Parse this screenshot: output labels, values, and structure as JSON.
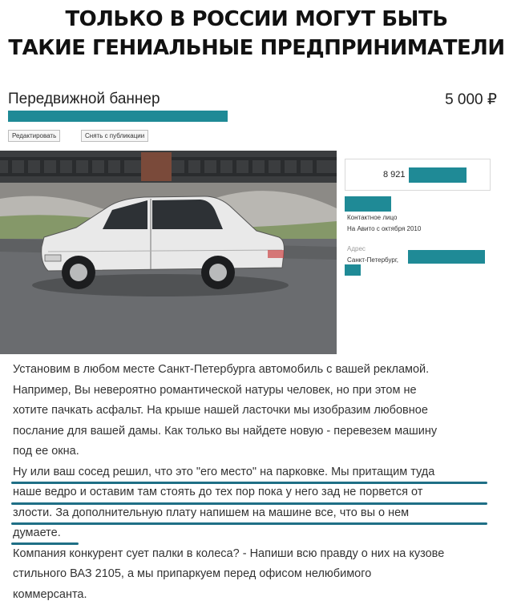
{
  "headline": {
    "line1": "ТОЛЬКО В РОССИИ МОГУТ БЫТЬ",
    "line2": "ТАКИЕ ГЕНИАЛЬНЫЕ ПРЕДПРИНИМАТЕЛИ"
  },
  "listing": {
    "title": "Передвижной баннер",
    "price": "5 000 ₽",
    "edit_button": "Редактировать",
    "unpublish_button": "Снять с публикации"
  },
  "seller": {
    "phone": "8 921",
    "contact_label": "Контактное лицо",
    "since": "На Авито с октября 2010",
    "address_label": "Адрес",
    "city": "Санкт-Петербург,"
  },
  "description": {
    "lines": [
      "Установим в любом месте Санкт-Петербурга автомобиль с вашей рекламой.",
      "Например, Вы невероятно романтической натуры человек, но при этом не",
      "хотите пачкать асфальт. На крыше нашей ласточки мы изобразим любовное",
      "послание для вашей дамы. Как только вы найдете новую - перевезем машину",
      "под ее окна.",
      "Ну или ваш сосед решил, что это \"его место\" на парковке. Мы притащим туда",
      "наше ведро и оставим там стоять до тех пор пока у него зад не порвется от",
      "злости. За дополнительную плату напишем на машине все, что вы о нем",
      "думаете.",
      "Компания конкурент сует палки в колеса? - Напиши всю правду о них на кузове",
      "стильного ВАЗ 2105, а мы припаркуем перед офисом нелюбимого",
      "коммерсанта."
    ]
  },
  "colors": {
    "redaction": "#1f8a96",
    "underline": "#1f6f86"
  }
}
